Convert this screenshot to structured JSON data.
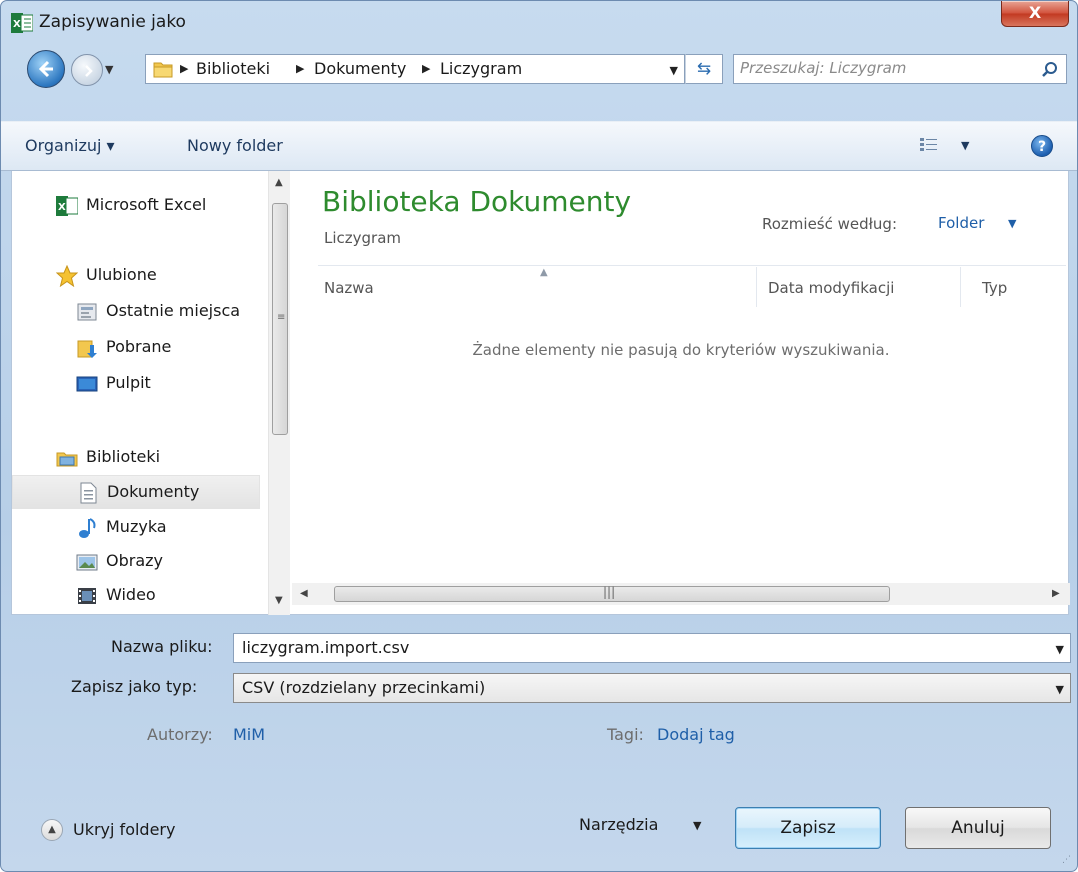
{
  "window": {
    "title": "Zapisywanie jako",
    "close_label": "X"
  },
  "address": {
    "crumbs": [
      "Biblioteki",
      "Dokumenty",
      "Liczygram"
    ],
    "search_placeholder": "Przeszukaj: Liczygram"
  },
  "toolbar": {
    "organize_label": "Organizuj ▾",
    "new_folder_label": "Nowy folder"
  },
  "nav": {
    "items": [
      {
        "label": "Microsoft Excel",
        "icon": "excel-icon"
      },
      {
        "label": "Ulubione",
        "icon": "star-icon"
      },
      {
        "label": "Ostatnie miejsca",
        "icon": "recent-places-icon"
      },
      {
        "label": "Pobrane",
        "icon": "downloads-icon"
      },
      {
        "label": "Pulpit",
        "icon": "desktop-icon"
      },
      {
        "label": "Biblioteki",
        "icon": "libraries-icon"
      },
      {
        "label": "Dokumenty",
        "icon": "documents-icon"
      },
      {
        "label": "Muzyka",
        "icon": "music-icon"
      },
      {
        "label": "Obrazy",
        "icon": "pictures-icon"
      },
      {
        "label": "Wideo",
        "icon": "video-icon"
      }
    ],
    "selected": "Dokumenty"
  },
  "content": {
    "title": "Biblioteka Dokumenty",
    "subtitle": "Liczygram",
    "arrange_label": "Rozmieść według:",
    "arrange_value": "Folder",
    "columns": [
      "Nazwa",
      "Data modyfikacji",
      "Typ"
    ],
    "empty_message": "Żadne elementy nie pasują do kryteriów wyszukiwania."
  },
  "form": {
    "filename_label": "Nazwa pliku:",
    "filename_value": "liczygram.import.csv",
    "filetype_label": "Zapisz jako typ:",
    "filetype_value": "CSV (rozdzielany przecinkami)",
    "authors_label": "Autorzy:",
    "authors_value": "MiM",
    "tags_label": "Tagi:",
    "tags_value": "Dodaj tag"
  },
  "footer": {
    "hide_folders_label": "Ukryj foldery",
    "tools_label": "Narzędzia",
    "save_label": "Zapisz",
    "cancel_label": "Anuluj"
  },
  "colors": {
    "library_title": "#2e8b2e",
    "link": "#1f5fa8",
    "close_button": "#c23a22"
  }
}
